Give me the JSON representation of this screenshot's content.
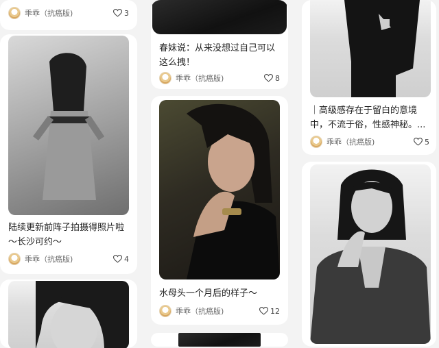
{
  "cards": [
    {
      "id": "c1",
      "title": "",
      "author": "乖乖（抗癌版)",
      "likes": "3"
    },
    {
      "id": "c2",
      "title": "陆续更新前阵子拍摄得照片啦～长沙可约～",
      "author": "乖乖（抗癌版)",
      "likes": "4"
    },
    {
      "id": "c3",
      "title": "",
      "author": "",
      "likes": ""
    },
    {
      "id": "c4",
      "title": "春妹说：从来没想过自己可以这么拽！",
      "author": "乖乖（抗癌版)",
      "likes": "8"
    },
    {
      "id": "c5",
      "title": "水母头一个月后的样子～",
      "author": "乖乖（抗癌版)",
      "likes": "12"
    },
    {
      "id": "c6",
      "title": "",
      "author": "",
      "likes": ""
    },
    {
      "id": "c7",
      "title": "｜高级感存在于留白的意境中，不流于俗，性感神秘。...",
      "author": "乖乖（抗癌版)",
      "likes": "5"
    },
    {
      "id": "c8",
      "title": "",
      "author": "",
      "likes": ""
    }
  ],
  "icons": {
    "avatar": "avatar-icon",
    "heart": "heart-icon"
  },
  "colors": {
    "background": "#f3f3f3",
    "card": "#ffffff",
    "text": "#222222",
    "meta": "#666666"
  }
}
